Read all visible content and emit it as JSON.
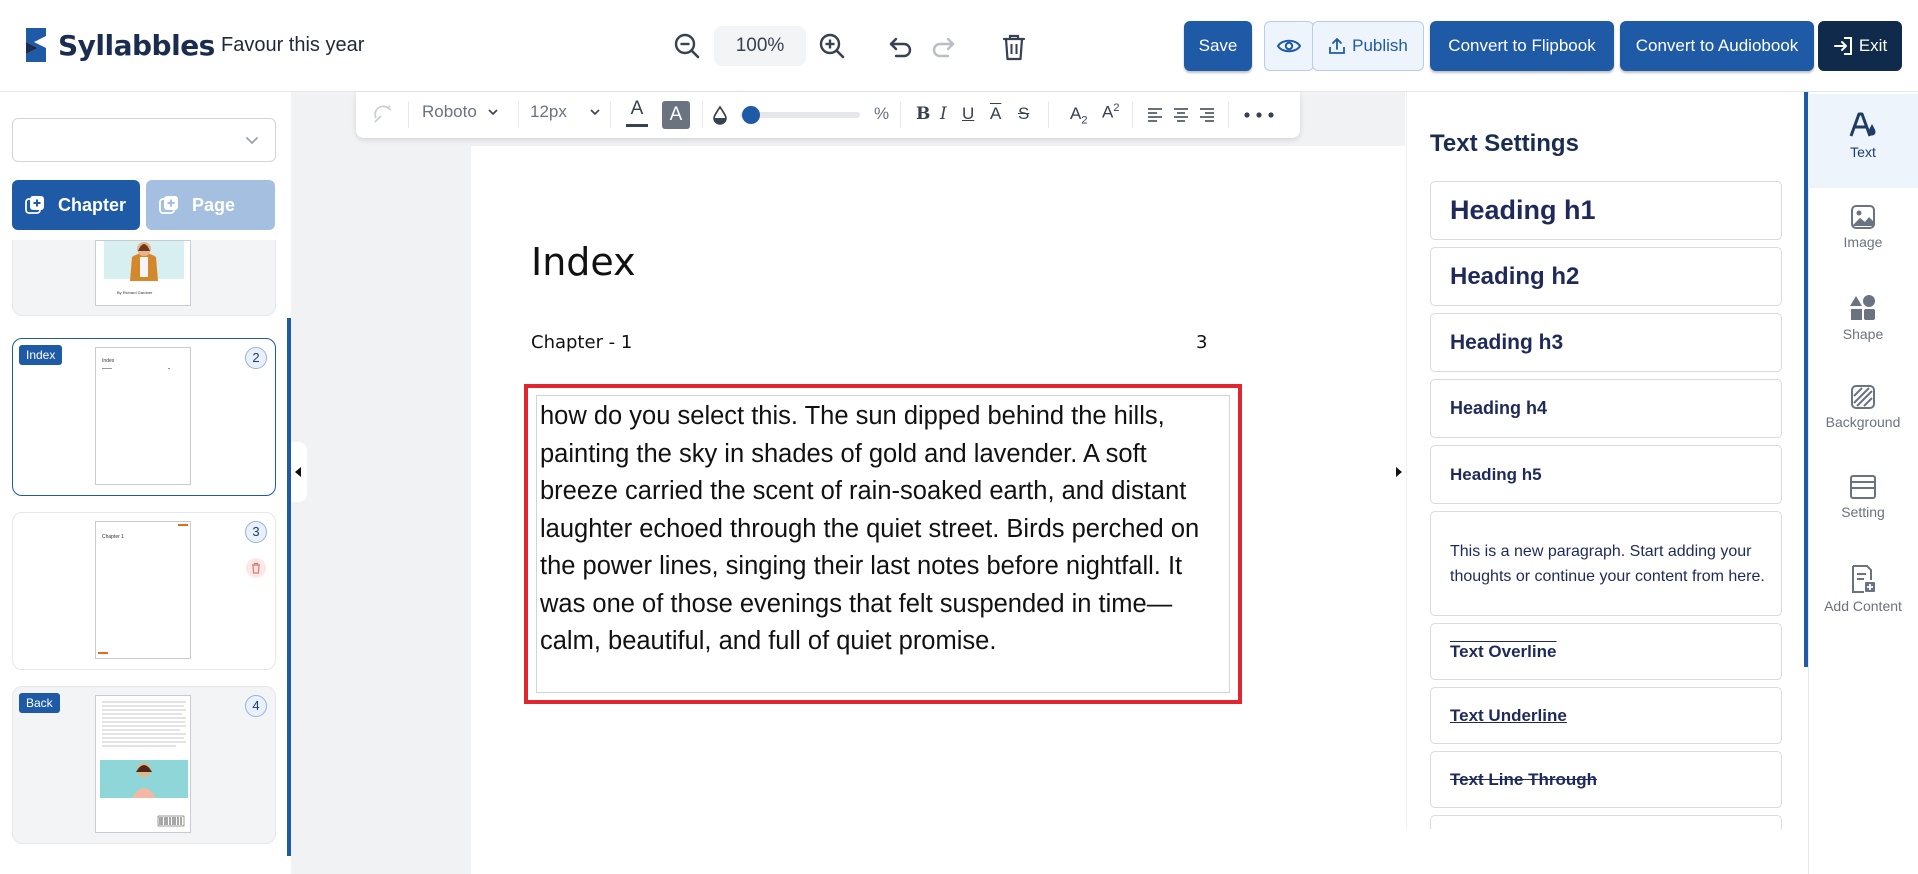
{
  "header": {
    "brand": "Syllabbles",
    "doc_title": "Favour this year",
    "zoom": "100%",
    "buttons": {
      "save": "Save",
      "publish": "Publish",
      "flipbook": "Convert to Flipbook",
      "audiobook": "Convert to Audiobook",
      "exit": "Exit"
    }
  },
  "left_panel": {
    "select_value": "",
    "add_chapter": "Chapter",
    "add_page": "Page",
    "cover_caption": "By Richard Gardner",
    "thumbs": [
      {
        "tag": "Index",
        "num": "2",
        "title": "Index"
      },
      {
        "tag": "",
        "num": "3",
        "title": "Chapter 1"
      },
      {
        "tag": "Back",
        "num": "4",
        "title": ""
      }
    ]
  },
  "toolbar": {
    "font_family": "Roboto",
    "font_size": "12px",
    "percent": "%",
    "color_letter": "A"
  },
  "page": {
    "heading": "Index",
    "toc_label": "Chapter - 1",
    "toc_page": "3",
    "body_text": "how do you select this. The sun dipped behind the hills, painting the sky in shades of gold and lavender. A soft breeze carried the scent of rain-soaked earth, and distant laughter echoed through the quiet street. Birds perched on the power lines, singing their last notes before nightfall. It was one of those evenings that felt suspended in time—calm, beautiful, and full of quiet promise."
  },
  "settings": {
    "title": "Text Settings",
    "items": {
      "h1": "Heading h1",
      "h2": "Heading h2",
      "h3": "Heading h3",
      "h4": "Heading h4",
      "h5": "Heading h5",
      "paragraph": "This is a new paragraph. Start adding your thoughts or continue your content from here.",
      "overline": "Text Overline",
      "underline": "Text Underline",
      "linethrough": "Text Line Through"
    }
  },
  "rail": {
    "text": "Text",
    "image": "Image",
    "shape": "Shape",
    "background": "Background",
    "setting": "Setting",
    "add_content": "Add Content"
  },
  "colors": {
    "brand": "#1a2d4f",
    "primary": "#1f5aa6",
    "selection": "#e0262e"
  }
}
